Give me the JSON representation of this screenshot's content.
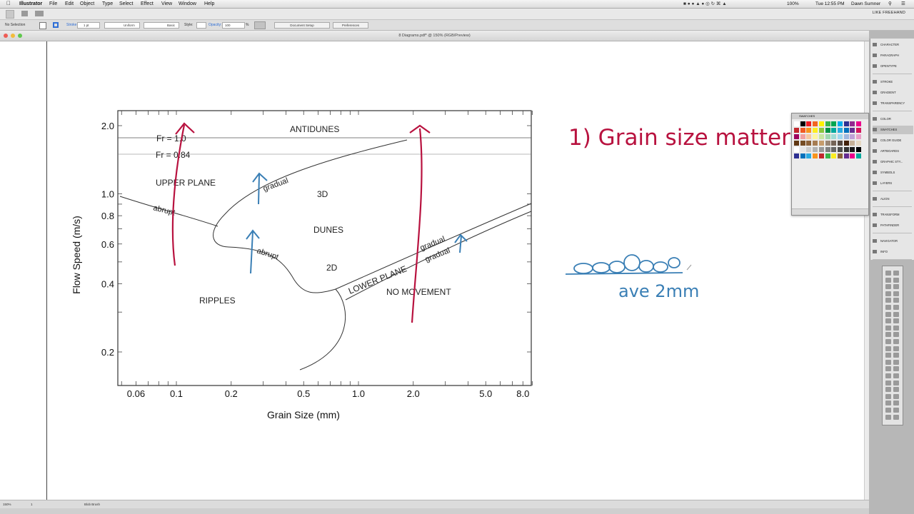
{
  "menubar": {
    "app_name": "Illustrator",
    "menus": [
      "File",
      "Edit",
      "Object",
      "Type",
      "Select",
      "Effect",
      "View",
      "Window",
      "Help"
    ],
    "battery": "100%",
    "clock": "Tue 12:55 PM",
    "user": "Dawn Sumner"
  },
  "workspace": "LIKE FREEHAND",
  "control": {
    "selection": "No Selection",
    "stroke_label": "Stroke:",
    "stroke_value": "1 pt",
    "profile_label": "Uniform",
    "brush_label": "Basic",
    "style_label": "Style:",
    "opacity_label": "Opacity:",
    "opacity_value": "100",
    "opacity_unit": "%",
    "document_setup": "Document Setup",
    "preferences": "Preferences"
  },
  "document": {
    "title": "8 Diagrams.pdf* @ 150% (RGB/Preview)"
  },
  "status": {
    "zoom": "150%",
    "page": "1",
    "tool": "Blob Brush"
  },
  "panels": {
    "items": [
      "CHARACTER",
      "PARAGRAPH",
      "OPENTYPE",
      "STROKE",
      "GRADIENT",
      "TRANSPARENCY",
      "COLOR",
      "SWATCHES",
      "COLOR GUIDE",
      "ARTBOARDS",
      "GRAPHIC STY...",
      "SYMBOLS",
      "LAYERS",
      "ALIGN",
      "TRANSFORM",
      "PATHFINDER",
      "NAVIGATOR",
      "INFO"
    ],
    "selected": "SWATCHES",
    "swatches_tab": "SWATCHES"
  },
  "colors": {
    "ink_red": "#b8123f",
    "ink_blue": "#3a7fb5",
    "accent_blue": "#2f6fd6"
  },
  "chart_data": {
    "type": "scatter",
    "title": "",
    "xlabel": "Grain Size (mm)",
    "ylabel": "Flow Speed (m/s)",
    "xscale": "log",
    "yscale": "log",
    "xlim": [
      0.05,
      9
    ],
    "ylim": [
      0.15,
      2.3
    ],
    "x_ticks": [
      0.06,
      0.1,
      0.2,
      0.5,
      1.0,
      2.0,
      5.0,
      8.0
    ],
    "x_tick_labels": [
      "0.06",
      "0.1",
      "0.2",
      "0.5",
      "1.0",
      "2.0",
      "5.0",
      "8.0"
    ],
    "y_ticks": [
      0.2,
      0.4,
      0.6,
      0.8,
      1.0,
      2.0
    ],
    "y_tick_labels": [
      "0.2",
      "0.4",
      "0.6",
      "0.8",
      "1.0",
      "2.0"
    ],
    "froude_lines": [
      "Fr = 1.0",
      "Fr = 0.84"
    ],
    "regions": [
      "ANTIDUNES",
      "UPPER PLANE",
      "3D",
      "DUNES",
      "2D",
      "RIPPLES",
      "LOWER PLANE",
      "NO MOVEMENT"
    ],
    "boundary_labels": [
      "gradual",
      "abrupt",
      "abrupt",
      "gradual",
      "gradual"
    ]
  },
  "annotations": {
    "heading": "1) Grain size matters",
    "note": "ave 2mm"
  }
}
